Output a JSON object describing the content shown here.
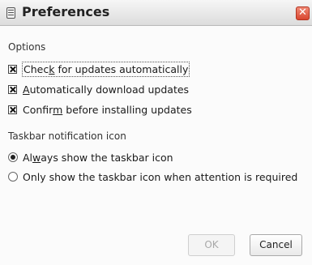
{
  "window": {
    "title": "Preferences",
    "close_glyph": "✕"
  },
  "options": {
    "heading": "Options",
    "items": [
      {
        "pre": "Chec",
        "mnemonic": "k",
        "post": " for updates automatically",
        "checked": true
      },
      {
        "pre": "",
        "mnemonic": "A",
        "post": "utomatically download updates",
        "checked": true
      },
      {
        "pre": "Confir",
        "mnemonic": "m",
        "post": " before installing updates",
        "checked": true
      }
    ]
  },
  "taskbar": {
    "heading": "Taskbar notification icon",
    "radios": [
      {
        "pre": "Al",
        "mnemonic": "w",
        "post": "ays show the taskbar icon",
        "selected": true
      },
      {
        "pre": "Only show the taskbar icon when attention is required",
        "mnemonic": "",
        "post": "",
        "selected": false
      }
    ]
  },
  "buttons": {
    "ok_label": "OK",
    "cancel_label": "Cancel"
  },
  "icons": {
    "window_menu": "window-menu-icon",
    "close": "close-icon"
  }
}
